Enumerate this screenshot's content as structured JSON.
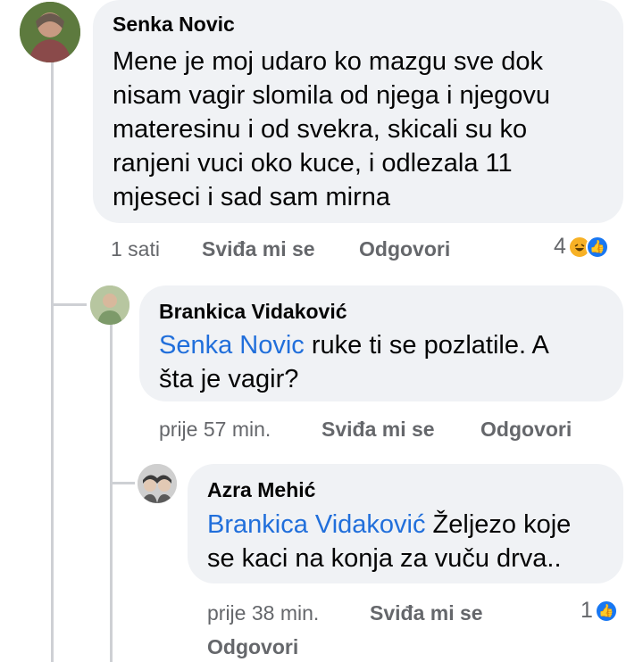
{
  "comments": [
    {
      "author": "Senka Novic",
      "lines": [
        "Mene je moj udaro ko mazgu sve dok",
        "nisam vagir slomila od njega i njegovu",
        "materesinu i od svekra, skicali su ko",
        "ranjeni vuci oko kuce, i odlezala 11",
        "mjeseci i sad sam mirna"
      ],
      "time": "1 sati",
      "like_label": "Sviđa mi se",
      "reply_label": "Odgovori",
      "reaction_count": "4",
      "reaction_icons": [
        "haha-icon",
        "like-icon"
      ]
    },
    {
      "author": "Brankica Vidaković",
      "mention": "Senka Novic",
      "line1_rest": " ruke ti se pozlatile. A",
      "line2": "šta je vagir?",
      "time": "prije 57 min.",
      "like_label": "Sviđa mi se",
      "reply_label": "Odgovori"
    },
    {
      "author": "Azra Mehić",
      "mention": "Brankica Vidaković",
      "line1_rest": " Željezo koje",
      "line2": "se kaci na konja za vuču drva..",
      "time": "prije 38 min.",
      "like_label": "Sviđa mi se",
      "reply_label": "Odgovori",
      "reaction_count": "1",
      "reaction_icons": [
        "like-icon"
      ]
    }
  ]
}
